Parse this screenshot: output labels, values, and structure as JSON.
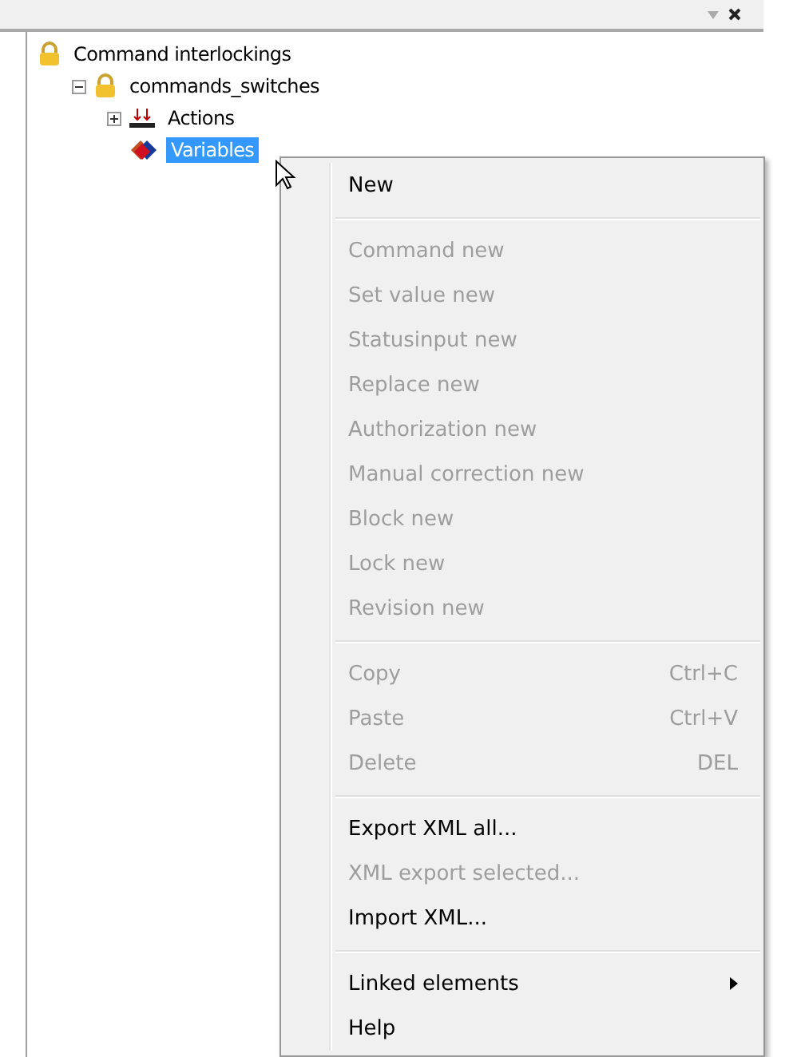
{
  "tree": [
    {
      "label": "Command interlockings",
      "kind": "lock",
      "selected": false,
      "children": [
        {
          "label": "commands_switches",
          "kind": "lock",
          "expanded": true,
          "selected": false,
          "children": [
            {
              "label": "Actions",
              "kind": "actions",
              "expanded": false,
              "selected": false
            },
            {
              "label": "Variables",
              "kind": "variables",
              "selected": true
            }
          ]
        }
      ]
    }
  ],
  "context_menu": [
    {
      "kind": "item",
      "label": "New",
      "disabled": false
    },
    {
      "kind": "separator"
    },
    {
      "kind": "item",
      "label": "Command new",
      "disabled": true
    },
    {
      "kind": "item",
      "label": "Set value new",
      "disabled": true
    },
    {
      "kind": "item",
      "label": "Statusinput new",
      "disabled": true
    },
    {
      "kind": "item",
      "label": "Replace new",
      "disabled": true
    },
    {
      "kind": "item",
      "label": "Authorization new",
      "disabled": true
    },
    {
      "kind": "item",
      "label": "Manual correction new",
      "disabled": true
    },
    {
      "kind": "item",
      "label": "Block new",
      "disabled": true
    },
    {
      "kind": "item",
      "label": "Lock new",
      "disabled": true
    },
    {
      "kind": "item",
      "label": "Revision new",
      "disabled": true
    },
    {
      "kind": "separator"
    },
    {
      "kind": "item",
      "label": "Copy",
      "shortcut": "Ctrl+C",
      "disabled": true
    },
    {
      "kind": "item",
      "label": "Paste",
      "shortcut": "Ctrl+V",
      "disabled": true
    },
    {
      "kind": "item",
      "label": "Delete",
      "shortcut": "DEL",
      "disabled": true
    },
    {
      "kind": "separator"
    },
    {
      "kind": "item",
      "label": "Export XML all...",
      "disabled": false
    },
    {
      "kind": "item",
      "label": "XML export selected...",
      "disabled": true
    },
    {
      "kind": "item",
      "label": "Import XML...",
      "disabled": false
    },
    {
      "kind": "separator"
    },
    {
      "kind": "item",
      "label": "Linked elements",
      "disabled": false,
      "submenu": true
    },
    {
      "kind": "item",
      "label": "Help",
      "disabled": false
    }
  ]
}
